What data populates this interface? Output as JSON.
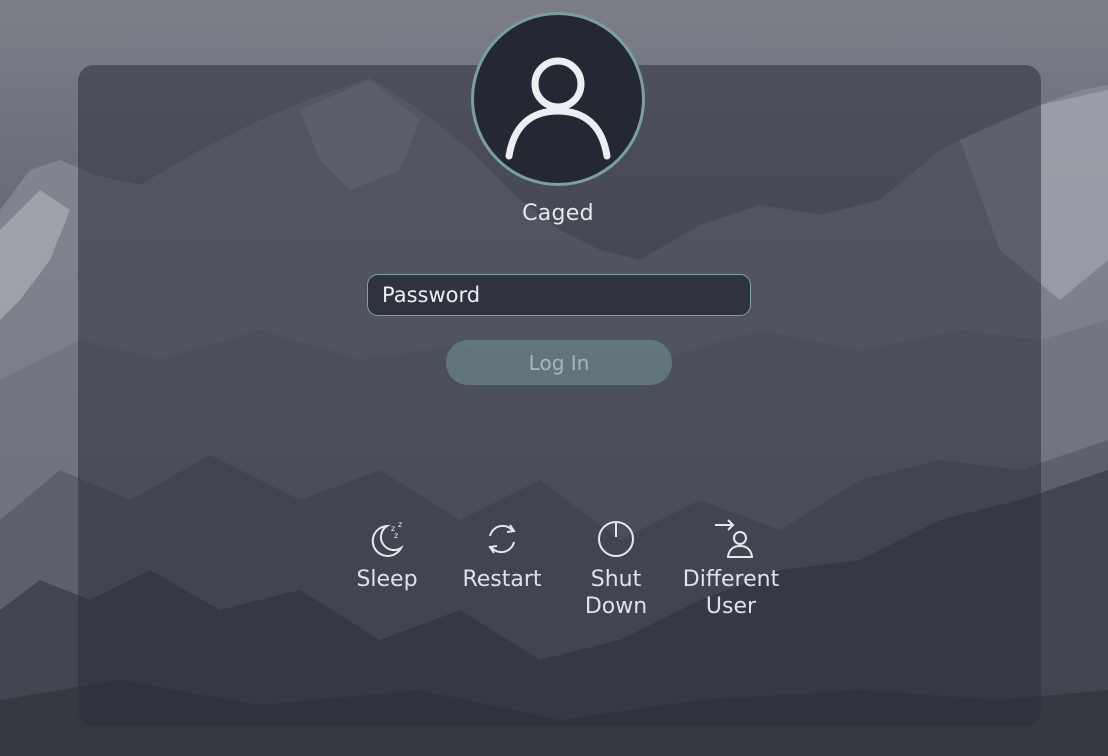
{
  "user": {
    "name": "Caged",
    "avatar_icon": "user-silhouette-icon"
  },
  "login_form": {
    "password_placeholder": "Password",
    "password_value": "",
    "login_label": "Log In"
  },
  "actions": [
    {
      "id": "sleep",
      "label": "Sleep",
      "icon": "moon-sleep-icon"
    },
    {
      "id": "restart",
      "label": "Restart",
      "icon": "restart-arrows-icon"
    },
    {
      "id": "shutdown",
      "label": "Shut\nDown",
      "icon": "power-icon"
    },
    {
      "id": "different_user",
      "label": "Different\nUser",
      "icon": "switch-user-icon"
    }
  ],
  "colors": {
    "panel": "#2c303c",
    "avatar_ring": "#7d9ea0",
    "avatar_bg": "#242832",
    "input_border": "#7fa0a6",
    "login_button": "#6e8a8e",
    "text": "#e6e8ec"
  }
}
